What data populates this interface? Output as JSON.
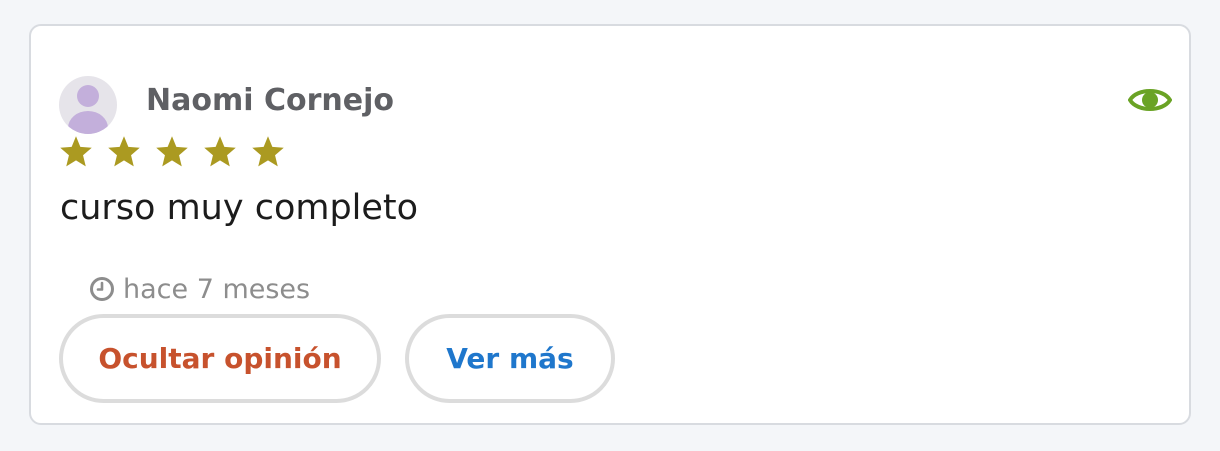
{
  "review": {
    "author": "Naomi Cornejo",
    "avatar_icon": "user-avatar-icon",
    "visibility_icon": "eye-icon",
    "rating": 5,
    "rating_max": 5,
    "text": "curso muy completo",
    "timestamp_icon": "clock-icon",
    "timestamp": "hace 7 meses"
  },
  "actions": {
    "hide_label": "Ocultar opinión",
    "more_label": "Ver más"
  },
  "colors": {
    "star": "#ab9a21",
    "eye": "#6aa325",
    "hide_button_text": "#c7522d",
    "more_button_text": "#1f77cc",
    "author_text": "#5f6064",
    "muted_text": "#8d8d8d",
    "avatar_fill": "#c3afdb",
    "avatar_bg": "#e6e4ea"
  }
}
